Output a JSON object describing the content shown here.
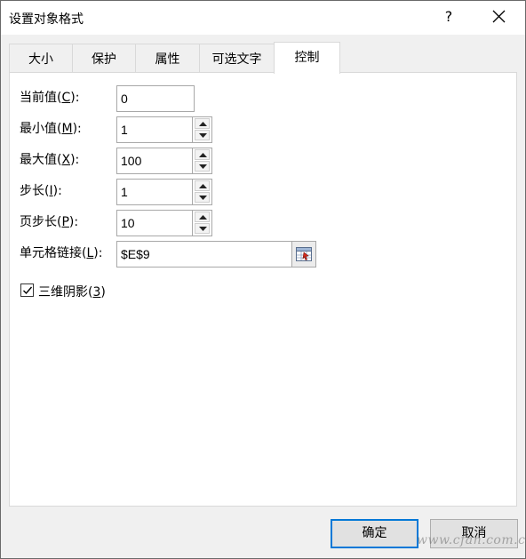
{
  "window": {
    "title": "设置对象格式",
    "help_label": "?",
    "close_icon": "close-icon"
  },
  "tabs": [
    {
      "label": "大小",
      "active": false
    },
    {
      "label": "保护",
      "active": false
    },
    {
      "label": "属性",
      "active": false
    },
    {
      "label": "可选文字",
      "active": false
    },
    {
      "label": "控制",
      "active": true
    }
  ],
  "fields": {
    "current_value": {
      "label": "当前值(",
      "key": "C",
      "suffix": "):",
      "value": "0"
    },
    "min_value": {
      "label": "最小值(",
      "key": "M",
      "suffix": "):",
      "value": "1"
    },
    "max_value": {
      "label": "最大值(",
      "key": "X",
      "suffix": "):",
      "value": "100"
    },
    "step": {
      "label": "步长(",
      "key": "I",
      "suffix": "):",
      "value": "1"
    },
    "page_step": {
      "label": "页步长(",
      "key": "P",
      "suffix": "):",
      "value": "10"
    },
    "cell_link": {
      "label": "单元格链接(",
      "key": "L",
      "suffix": "):",
      "value": "$E$9"
    }
  },
  "shading": {
    "label": "三维阴影(",
    "key": "3",
    "suffix": ")",
    "checked": true
  },
  "buttons": {
    "ok": "确定",
    "cancel": "取消"
  },
  "watermark": "www.cfan.com.cn",
  "colors": {
    "accent": "#0078d7",
    "panel_bg": "#ffffff",
    "dialog_bg": "#f0f0f0"
  }
}
